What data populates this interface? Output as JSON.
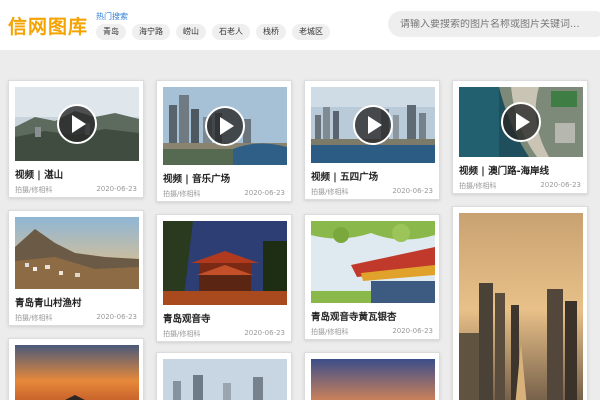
{
  "header": {
    "logo": "信网图库",
    "hot_label": "热门搜索",
    "tags": [
      "青岛",
      "海宁路",
      "崂山",
      "石老人",
      "栈桥",
      "老城区"
    ],
    "search_placeholder": "请输入要搜索的图片名称或图片关键词..."
  },
  "cards": [
    {
      "title": "视频 | 湛山",
      "source": "拍摄/修相科",
      "date": "2020-06-23",
      "is_video": true
    },
    {
      "title": "视频 | 音乐广场",
      "source": "拍摄/修相科",
      "date": "2020-06-23",
      "is_video": true
    },
    {
      "title": "视频 | 五四广场",
      "source": "拍摄/修相科",
      "date": "2020-06-23",
      "is_video": true
    },
    {
      "title": "视频 | 澳门路-海岸线",
      "source": "拍摄/修相科",
      "date": "2020-06-23",
      "is_video": true
    },
    {
      "title": "青岛青山村渔村",
      "source": "拍摄/修相科",
      "date": "2020-06-23",
      "is_video": false
    },
    {
      "title": "青岛观音寺",
      "source": "拍摄/修相科",
      "date": "2020-06-23",
      "is_video": false
    },
    {
      "title": "青岛观音寺黄瓦银杏",
      "source": "拍摄/修相科",
      "date": "2020-06-23",
      "is_video": false
    },
    {
      "title": "",
      "source": "",
      "date": "",
      "is_video": false
    },
    {
      "title": "",
      "source": "",
      "date": "",
      "is_video": false
    },
    {
      "title": "",
      "source": "",
      "date": "",
      "is_video": false
    },
    {
      "title": "",
      "source": "",
      "date": "",
      "is_video": false
    }
  ],
  "colors": {
    "logo": "#f5a300",
    "hot_label": "#2d7ddc",
    "background": "#ececec"
  }
}
